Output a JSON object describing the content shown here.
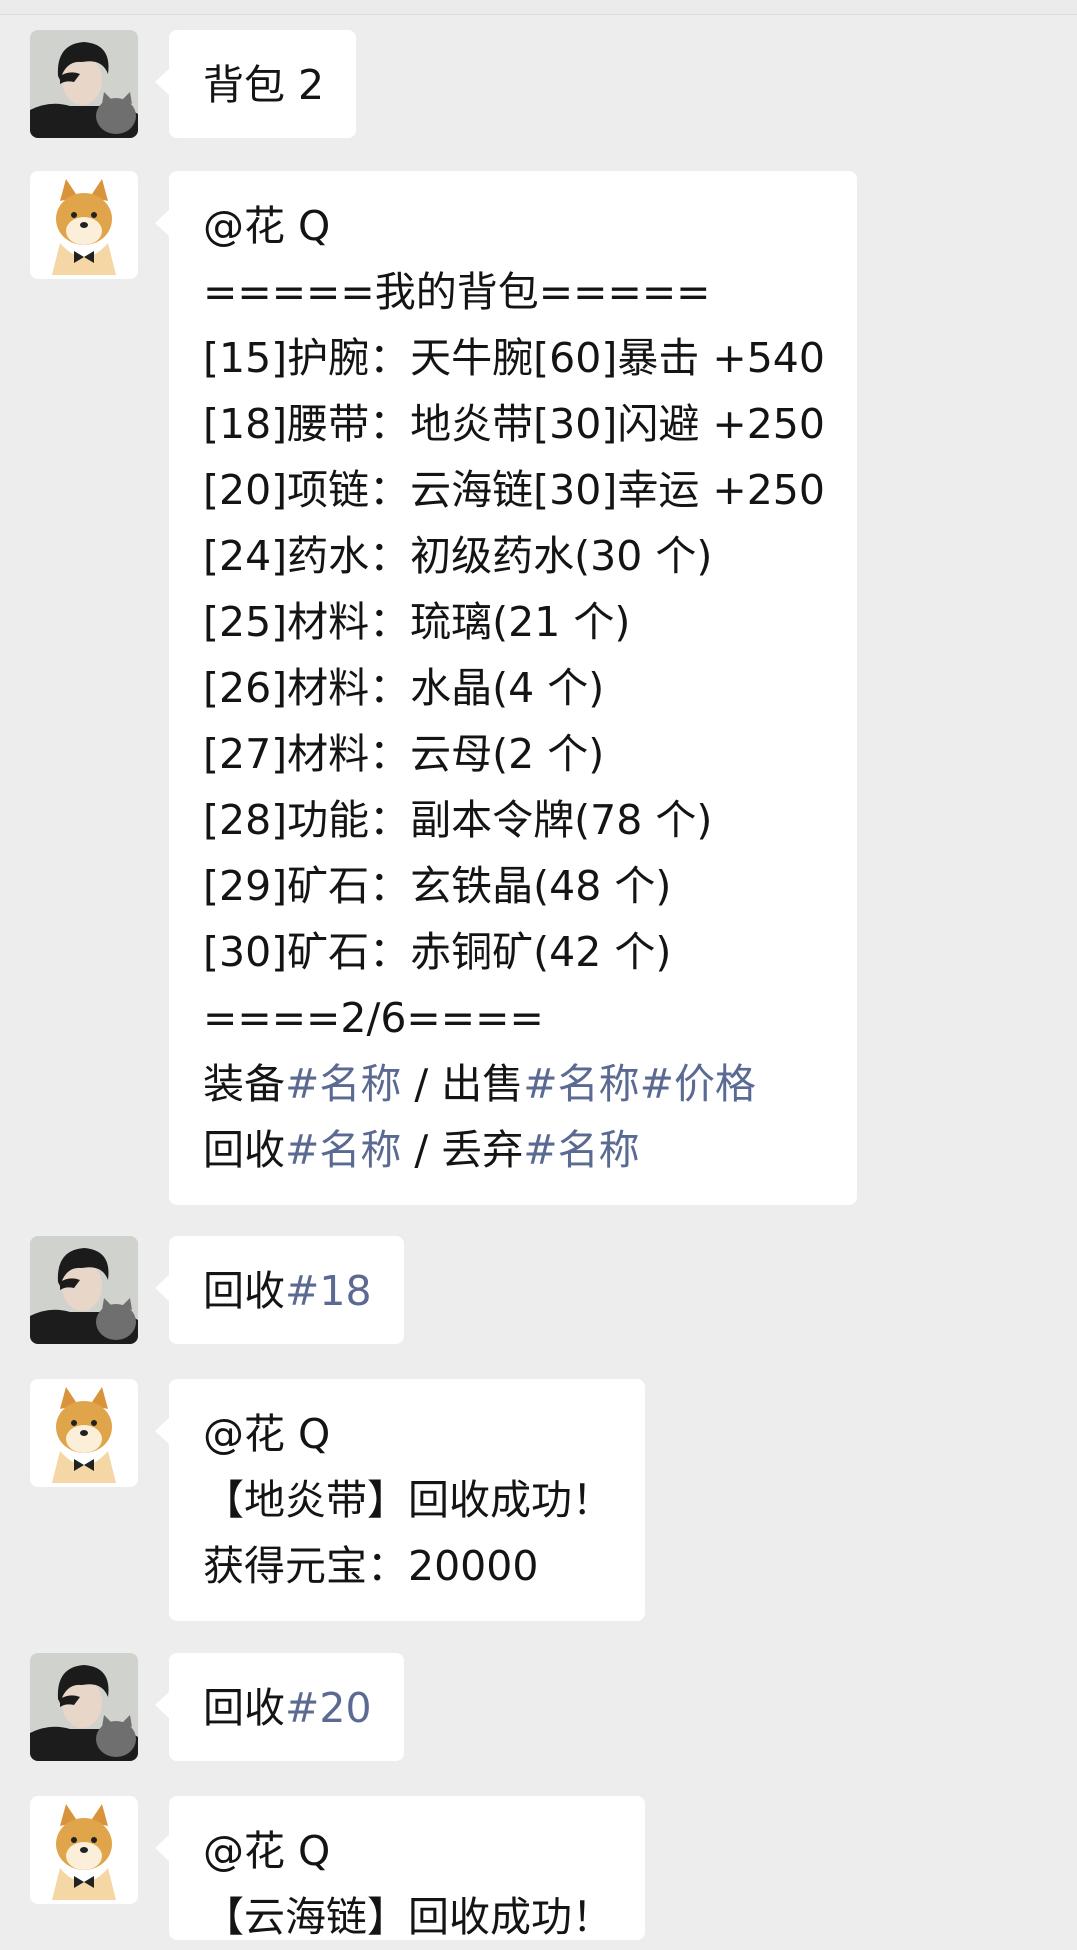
{
  "messages": [
    {
      "sender": "user",
      "lines": [
        [
          {
            "t": "背包 2"
          }
        ]
      ]
    },
    {
      "sender": "bot",
      "lines": [
        [
          {
            "t": "@花 Q"
          }
        ],
        [
          {
            "t": "=====我的背包====="
          }
        ],
        [
          {
            "t": "[15]护腕：天牛腕[60]暴击 +540"
          }
        ],
        [
          {
            "t": "[18]腰带：地炎带[30]闪避 +250"
          }
        ],
        [
          {
            "t": "[20]项链：云海链[30]幸运 +250"
          }
        ],
        [
          {
            "t": "[24]药水：初级药水(30 个)"
          }
        ],
        [
          {
            "t": "[25]材料：琉璃(21 个)"
          }
        ],
        [
          {
            "t": "[26]材料：水晶(4 个)"
          }
        ],
        [
          {
            "t": "[27]材料：云母(2 个)"
          }
        ],
        [
          {
            "t": "[28]功能：副本令牌(78 个)"
          }
        ],
        [
          {
            "t": "[29]矿石：玄铁晶(48 个)"
          }
        ],
        [
          {
            "t": "[30]矿石：赤铜矿(42 个)"
          }
        ],
        [
          {
            "t": "====2/6===="
          }
        ],
        [
          {
            "t": "装备"
          },
          {
            "t": "#名称",
            "tag": true
          },
          {
            "t": " / 出售"
          },
          {
            "t": "#名称#价格",
            "tag": true
          }
        ],
        [
          {
            "t": "回收"
          },
          {
            "t": "#名称",
            "tag": true
          },
          {
            "t": " / 丢弃"
          },
          {
            "t": "#名称",
            "tag": true
          }
        ]
      ]
    },
    {
      "sender": "user",
      "lines": [
        [
          {
            "t": "回收"
          },
          {
            "t": "#18",
            "tag": true
          }
        ]
      ]
    },
    {
      "sender": "bot",
      "lines": [
        [
          {
            "t": "@花 Q"
          }
        ],
        [
          {
            "t": "【地炎带】回收成功！"
          }
        ],
        [
          {
            "t": "获得元宝：20000"
          }
        ]
      ]
    },
    {
      "sender": "user",
      "lines": [
        [
          {
            "t": "回收"
          },
          {
            "t": "#20",
            "tag": true
          }
        ]
      ]
    },
    {
      "sender": "bot",
      "lines": [
        [
          {
            "t": "@花 Q"
          }
        ],
        [
          {
            "t": "【云海链】回收成功！"
          }
        ]
      ]
    }
  ]
}
